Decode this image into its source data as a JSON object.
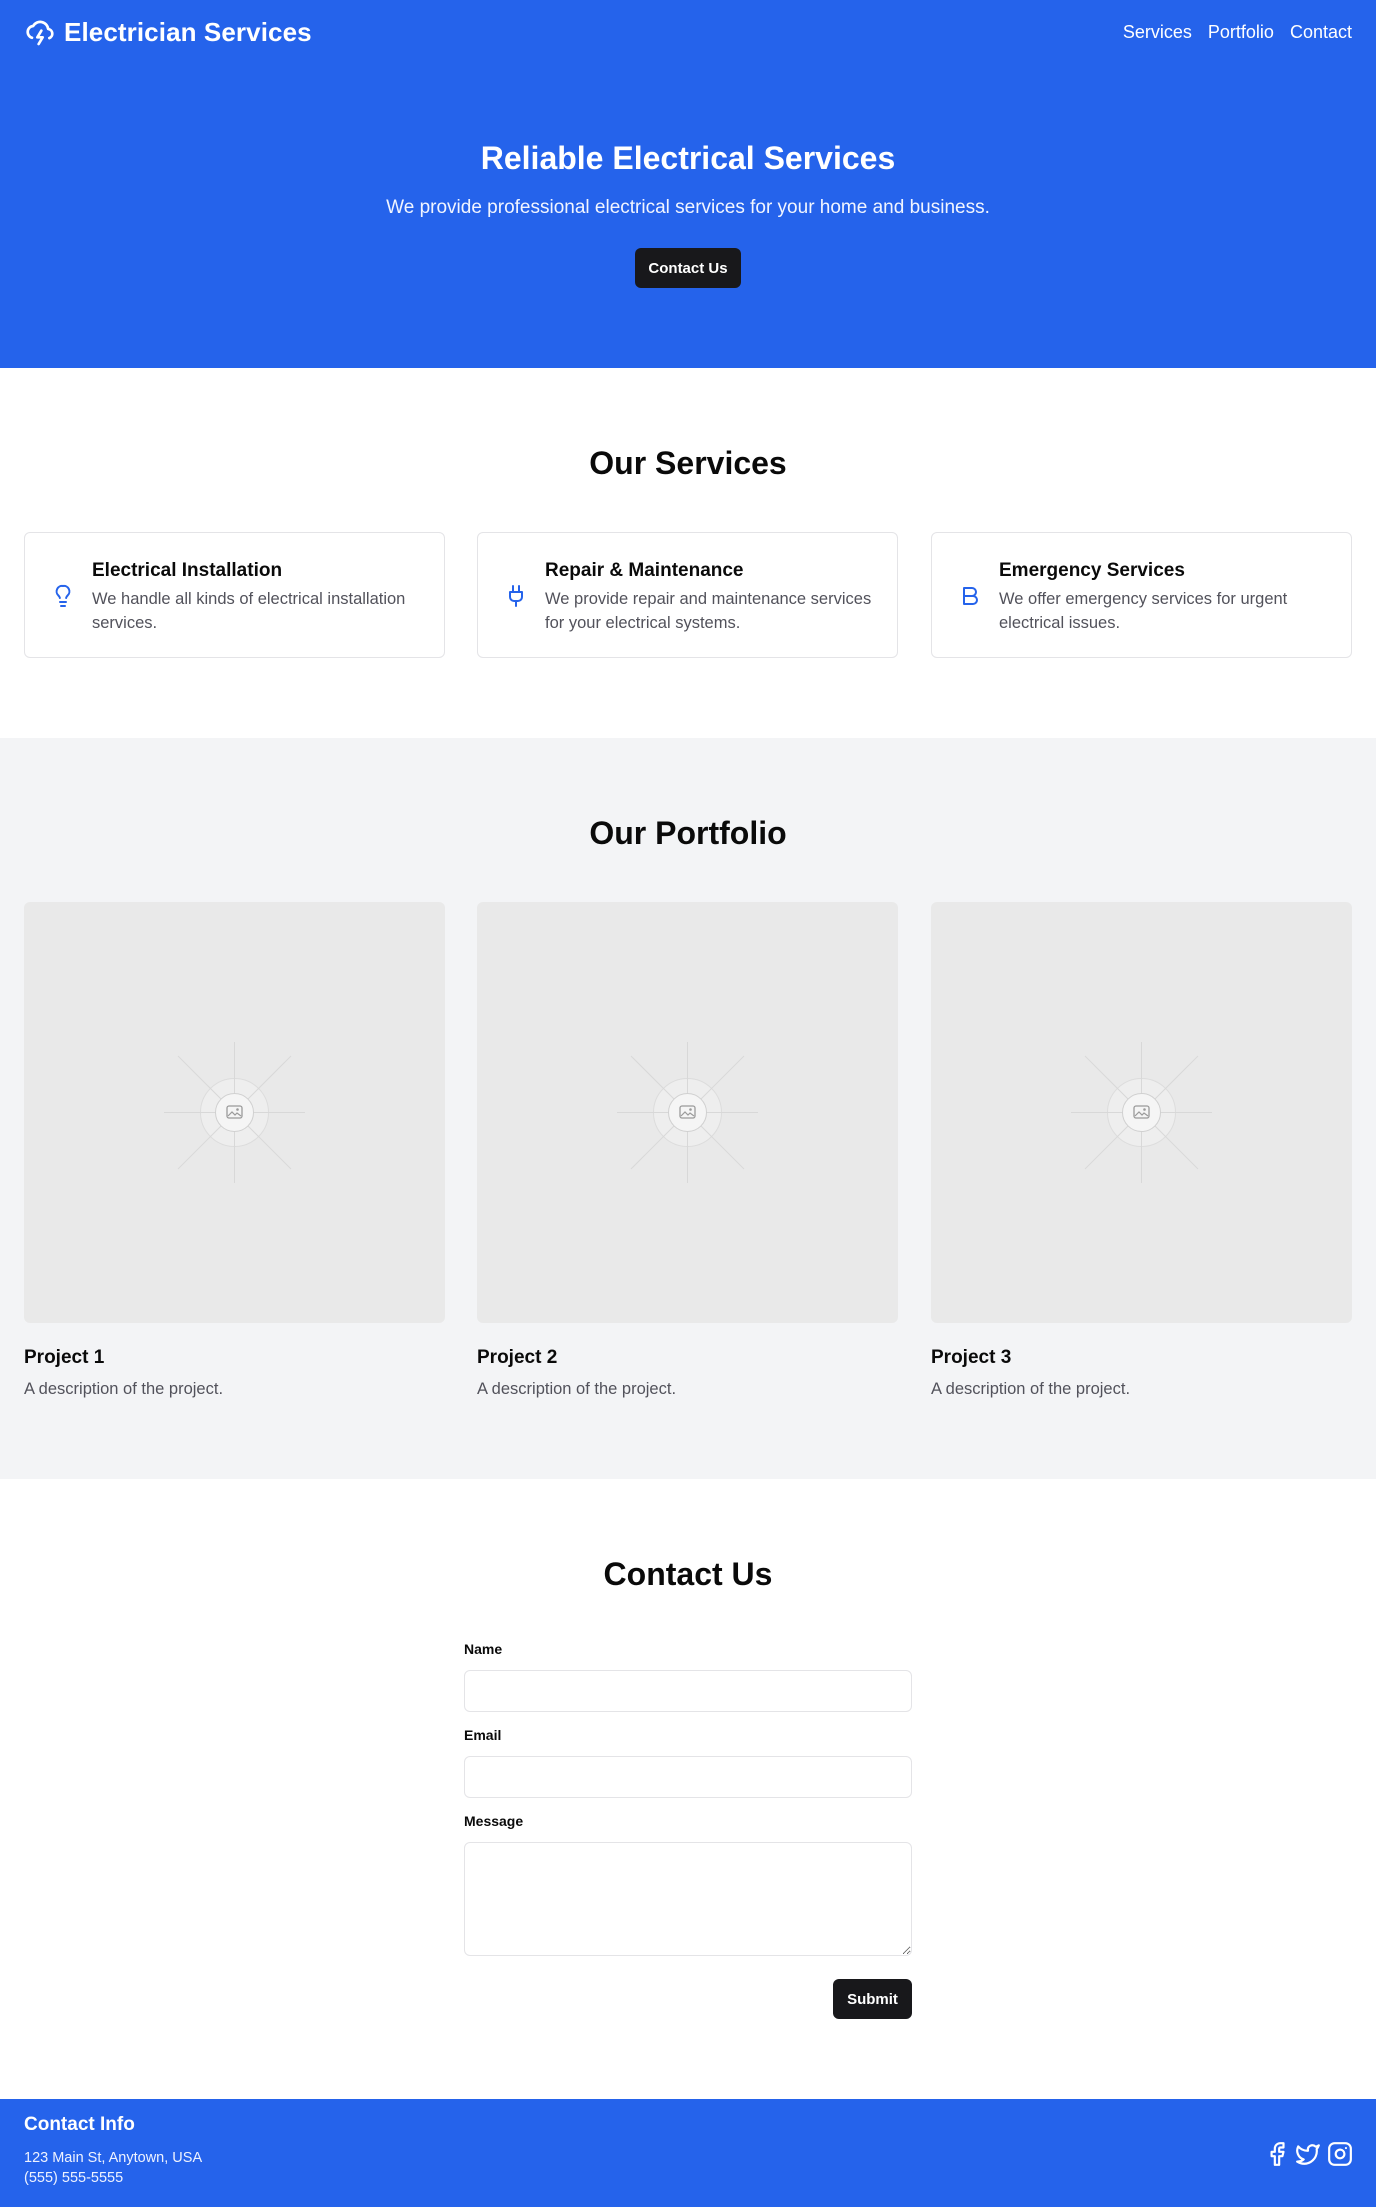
{
  "header": {
    "brand": "Electrician Services",
    "brand_icon": "cloud-lightning-icon",
    "nav": [
      "Services",
      "Portfolio",
      "Contact"
    ]
  },
  "hero": {
    "title": "Reliable Electrical Services",
    "subtitle": "We provide professional electrical services for your home and business.",
    "cta": "Contact Us"
  },
  "services": {
    "title": "Our Services",
    "items": [
      {
        "icon": "lightbulb-icon",
        "title": "Electrical Installation",
        "description": "We handle all kinds of electrical installation services."
      },
      {
        "icon": "plug-icon",
        "title": "Repair & Maintenance",
        "description": "We provide repair and maintenance services for your electrical systems."
      },
      {
        "icon": "bold-b-icon",
        "title": "Emergency Services",
        "description": "We offer emergency services for urgent electrical issues."
      }
    ]
  },
  "portfolio": {
    "title": "Our Portfolio",
    "items": [
      {
        "title": "Project 1",
        "description": "A description of the project."
      },
      {
        "title": "Project 2",
        "description": "A description of the project."
      },
      {
        "title": "Project 3",
        "description": "A description of the project."
      }
    ]
  },
  "contact": {
    "title": "Contact Us",
    "name_label": "Name",
    "name_value": "",
    "email_label": "Email",
    "email_value": "",
    "message_label": "Message",
    "message_value": "",
    "submit": "Submit"
  },
  "footer": {
    "title": "Contact Info",
    "address": "123 Main St, Anytown, USA",
    "phone": "(555) 555-5555",
    "social": [
      "facebook-icon",
      "twitter-icon",
      "instagram-icon"
    ]
  },
  "colors": {
    "brand_blue": "#2563eb",
    "button_dark": "#18181b",
    "muted_text": "#52525b",
    "portfolio_bg": "#f3f4f6"
  }
}
